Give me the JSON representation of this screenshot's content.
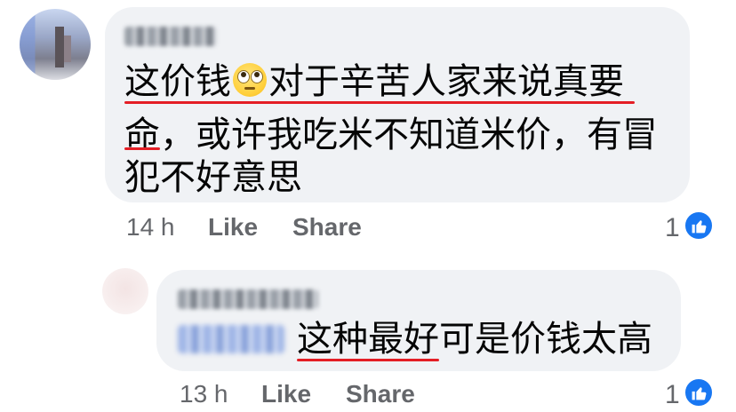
{
  "comments": [
    {
      "author": "",
      "text_lines": [
        "这价钱",
        "对于辛苦人家来说真要",
        "命，或许我吃米不知道米价，有冒",
        "犯不好意思"
      ],
      "emoji": "face-with-rolling-eyes",
      "time": "14 h",
      "like_label": "Like",
      "share_label": "Share",
      "reaction_count": "1",
      "reaction_icon": "like-icon",
      "colors": {
        "bubble": "#f0f2f5",
        "meta": "#65676b",
        "text": "#050505",
        "underline": "#e41e25",
        "like": "#1877f2"
      }
    },
    {
      "author": "",
      "mention": "",
      "text": "这种最好可是价钱太高",
      "time": "13 h",
      "like_label": "Like",
      "share_label": "Share",
      "reaction_count": "1",
      "reaction_icon": "like-icon"
    }
  ]
}
